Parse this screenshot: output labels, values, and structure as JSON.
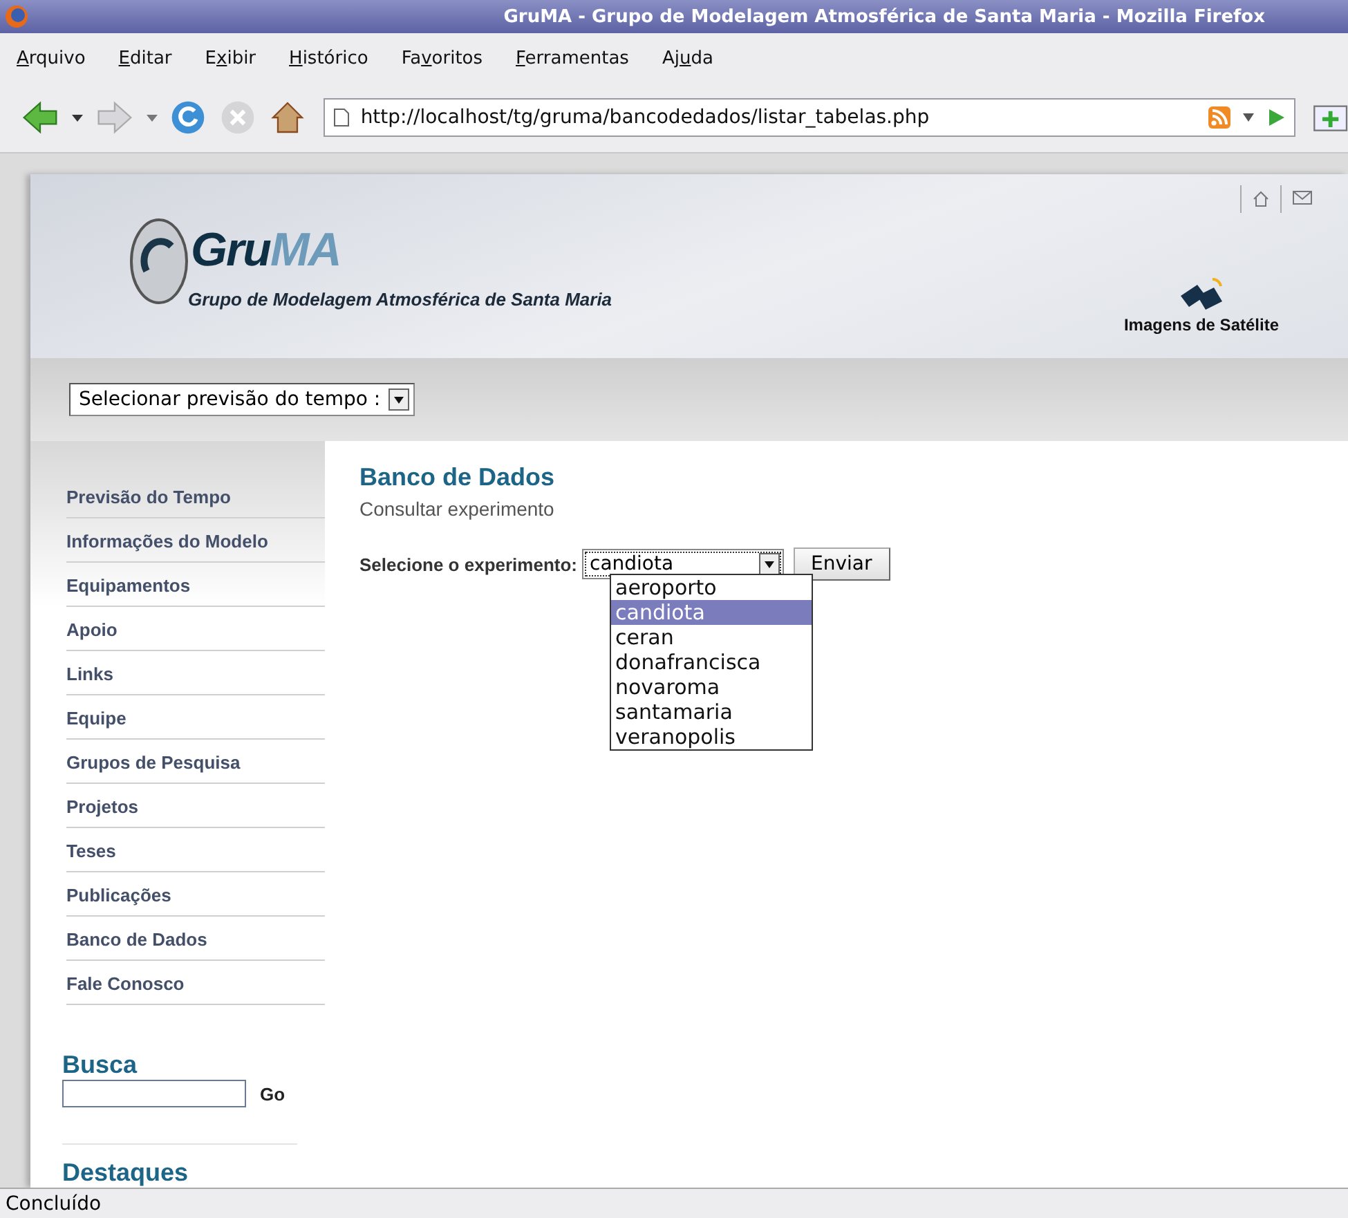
{
  "window": {
    "title": "GruMA - Grupo de Modelagem Atmosférica de Santa Maria - Mozilla Firefox"
  },
  "menu": [
    {
      "key": "A",
      "rest": "rquivo"
    },
    {
      "key": "E",
      "rest": "ditar"
    },
    {
      "start": "E",
      "key": "x",
      "rest": "ibir"
    },
    {
      "key": "H",
      "rest": "istórico"
    },
    {
      "start": "Fa",
      "key": "v",
      "rest": "oritos"
    },
    {
      "key": "F",
      "rest": "erramentas"
    },
    {
      "start": "Aj",
      "key": "u",
      "rest": "da"
    }
  ],
  "address": {
    "value": "http://localhost/tg/gruma/bancodedados/listar_tabelas.php"
  },
  "header": {
    "logo_dark": "Gru",
    "logo_light": "MA",
    "subtitle": "Grupo de Modelagem Atmosférica de Santa Maria",
    "satellite_link": "Imagens de Satélite"
  },
  "forecast_select": {
    "value": "Selecionar previsão do tempo :"
  },
  "sidebar": {
    "items": [
      {
        "label": "Previsão do Tempo"
      },
      {
        "label": "Informações do Modelo"
      },
      {
        "label": "Equipamentos"
      },
      {
        "label": "Apoio"
      },
      {
        "label": "Links"
      },
      {
        "label": "Equipe"
      },
      {
        "label": "Grupos de Pesquisa"
      },
      {
        "label": "Projetos"
      },
      {
        "label": "Teses"
      },
      {
        "label": "Publicações"
      },
      {
        "label": "Banco de Dados"
      },
      {
        "label": "Fale Conosco"
      }
    ],
    "search": {
      "title": "Busca",
      "button": "Go"
    },
    "highlights": {
      "title": "Destaques"
    }
  },
  "content": {
    "title": "Banco de Dados",
    "subtitle": "Consultar experimento",
    "form_label": "Selecione o experimento:",
    "select_value": "candiota",
    "submit": "Enviar",
    "options": [
      {
        "label": "aeroporto",
        "selected": false
      },
      {
        "label": "candiota",
        "selected": true
      },
      {
        "label": "ceran",
        "selected": false
      },
      {
        "label": "donafrancisca",
        "selected": false
      },
      {
        "label": "novaroma",
        "selected": false
      },
      {
        "label": "santamaria",
        "selected": false
      },
      {
        "label": "veranopolis",
        "selected": false
      }
    ]
  },
  "status_bar": {
    "text": "Concluído"
  }
}
